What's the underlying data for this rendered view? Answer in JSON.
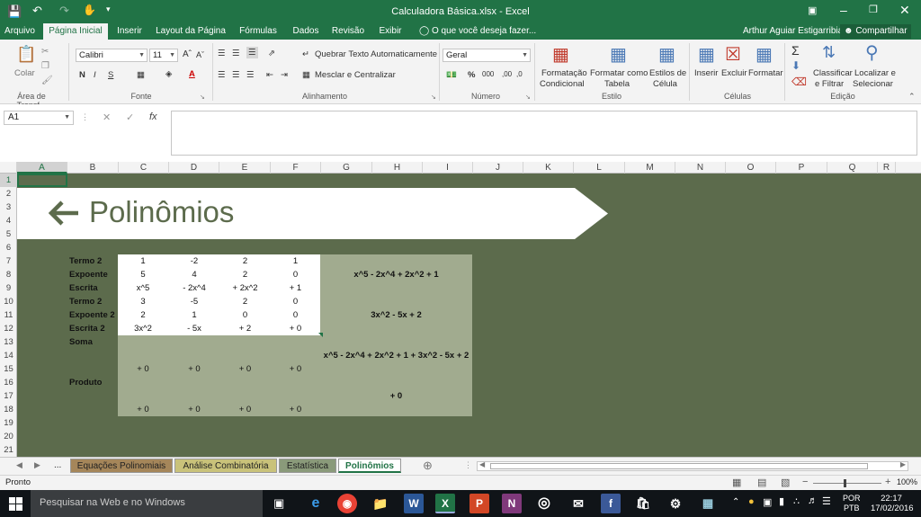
{
  "window": {
    "title": "Calculadora Básica.xlsx - Excel",
    "user": "Arthur Aguiar Estigarribia",
    "share_label": "Compartilhar",
    "tell_me": "O que você deseja fazer..."
  },
  "tabs": [
    "Arquivo",
    "Página Inicial",
    "Inserir",
    "Layout da Página",
    "Fórmulas",
    "Dados",
    "Revisão",
    "Exibir"
  ],
  "ribbon": {
    "paste_label": "Colar",
    "clipboard_label": "Área de Transf...",
    "font_name": "Calibri",
    "font_size": "11",
    "font_group": "Fonte",
    "wrap_text": "Quebrar Texto Automaticamente",
    "merge_center": "Mesclar e Centralizar",
    "alignment_group": "Alinhamento",
    "number_format": "Geral",
    "number_group": "Número",
    "cond_format_1": "Formatação",
    "cond_format_2": "Condicional",
    "format_table_1": "Formatar como",
    "format_table_2": "Tabela",
    "cell_styles_1": "Estilos de",
    "cell_styles_2": "Célula",
    "styles_group": "Estilo",
    "insert": "Inserir",
    "delete": "Excluir",
    "format": "Formatar",
    "cells_group": "Células",
    "sort_1": "Classificar",
    "sort_2": "e Filtrar",
    "find_1": "Localizar e",
    "find_2": "Selecionar",
    "editing_group": "Edição"
  },
  "formula_bar": {
    "name_box": "A1",
    "fx": "fx",
    "content": ""
  },
  "columns": [
    "A",
    "B",
    "C",
    "D",
    "E",
    "F",
    "G",
    "H",
    "I",
    "J",
    "K",
    "L",
    "M",
    "N",
    "O",
    "P",
    "Q",
    "R"
  ],
  "rows": [
    "1",
    "2",
    "3",
    "4",
    "5",
    "6",
    "7",
    "8",
    "9",
    "10",
    "11",
    "12",
    "13",
    "14",
    "15",
    "16",
    "17",
    "18",
    "19",
    "20",
    "21"
  ],
  "sheet": {
    "banner_title": "Polinômios",
    "labels": {
      "termo2_a": "Termo 2",
      "expoente": "Expoente",
      "escrita": "Escrita",
      "termo2_b": "Termo 2",
      "expoente2": "Expoente 2",
      "escrita2": "Escrita 2",
      "soma": "Soma",
      "produto": "Produto"
    },
    "grid": [
      [
        "1",
        "-2",
        "2",
        "1"
      ],
      [
        "5",
        "4",
        "2",
        "0"
      ],
      [
        "x^5",
        "- 2x^4",
        "+ 2x^2",
        "+ 1"
      ],
      [
        "3",
        "-5",
        "2",
        "0"
      ],
      [
        "2",
        "1",
        "0",
        "0"
      ],
      [
        "3x^2",
        "- 5x",
        "+ 2",
        "+ 0"
      ]
    ],
    "soma_row": [
      "+ 0",
      "+ 0",
      "+ 0",
      "+ 0"
    ],
    "produto_row": [
      "+ 0",
      "+ 0",
      "+ 0",
      "+ 0"
    ],
    "poly1": "x^5 - 2x^4 + 2x^2 + 1",
    "poly2": "3x^2 - 5x + 2",
    "sum_result": "x^5 - 2x^4 + 2x^2 + 1 + 3x^2 - 5x + 2",
    "product_result": "+ 0"
  },
  "sheet_tabs": {
    "more": "...",
    "items": [
      "Equações Polinomiais",
      "Análise Combinatória",
      "Estatística",
      "Polinômios"
    ],
    "colors": [
      "#a5865a",
      "#c9c27a",
      "#8a9a7a",
      "#ffffff"
    ]
  },
  "status": {
    "ready": "Pronto",
    "zoom": "100%"
  },
  "taskbar": {
    "search_placeholder": "Pesquisar na Web e no Windows",
    "lang_1": "POR",
    "lang_2": "PTB",
    "time": "22:17",
    "date": "17/02/2016"
  }
}
